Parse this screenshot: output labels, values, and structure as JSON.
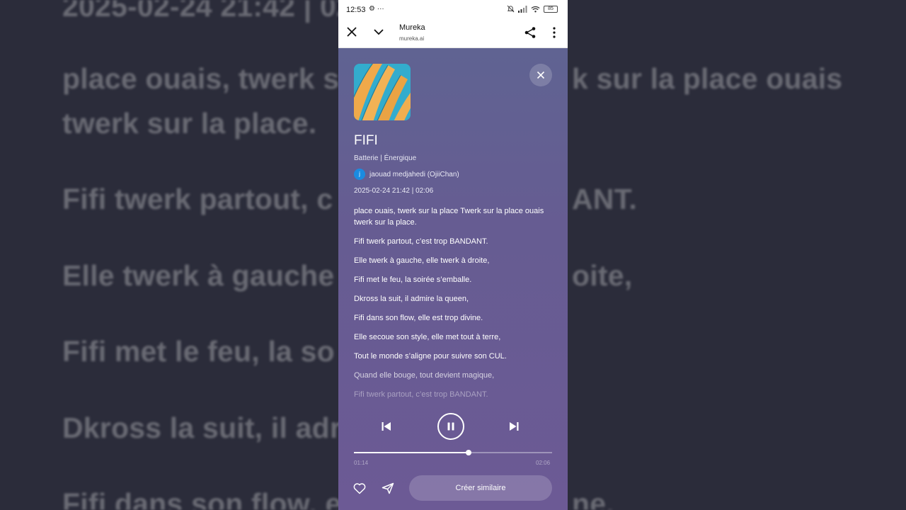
{
  "background_lyrics": [
    "2025-02-24 21:42 | 02",
    "place ouais, twerk s",
    "k sur la place ouais",
    "twerk sur la place.",
    "Fifi twerk partout, c",
    "ANT.",
    "Elle twerk à gauche",
    "oite,",
    "Fifi met le feu, la so",
    "Dkross la suit, il adr",
    "Fifi dans son flow, e",
    "ne."
  ],
  "status_bar": {
    "time": "12:53",
    "left_icons": "⚙ ···",
    "battery": "85"
  },
  "browser_bar": {
    "title": "Mureka",
    "url": "mureka.ai"
  },
  "song": {
    "title": "FIFI",
    "tags": "Batterie | Énergique",
    "author_initial": "j",
    "author": "jaouad medjahedi (OjiiChan)",
    "meta": "2025-02-24 21:42 | 02:06"
  },
  "lyrics": [
    {
      "text": "place ouais, twerk sur la place Twerk sur la place ouais twerk sur la place.",
      "style": "bright"
    },
    {
      "text": "Fifi twerk partout, c’est trop BANDANT.",
      "style": "bright"
    },
    {
      "text": "Elle twerk à gauche, elle twerk à droite,",
      "style": "bright"
    },
    {
      "text": "Fifi met le feu, la soirée s’emballe.",
      "style": "bright"
    },
    {
      "text": "Dkross la suit, il admire la queen,",
      "style": "bright"
    },
    {
      "text": "Fifi dans son flow, elle est trop divine.",
      "style": "bright"
    },
    {
      "text": "Elle secoue son style, elle met tout à terre,",
      "style": "bright"
    },
    {
      "text": "Tout le monde s’aligne pour suivre son CUL.",
      "style": "bright"
    },
    {
      "text": "Quand elle bouge, tout devient magique,",
      "style": "dim1"
    },
    {
      "text": "Fifi twerk partout, c’est trop BANDANT.",
      "style": "dim2"
    }
  ],
  "player": {
    "progress": 0.58,
    "current_time": "01:14",
    "total_time": "02:06"
  },
  "actions": {
    "create_similar": "Créer similaire"
  },
  "colors": {
    "bg_dark": "#2b2c3a",
    "panel_top": "#5e6592",
    "panel_bottom": "#6c5a95",
    "avatar": "#1b8be0"
  }
}
